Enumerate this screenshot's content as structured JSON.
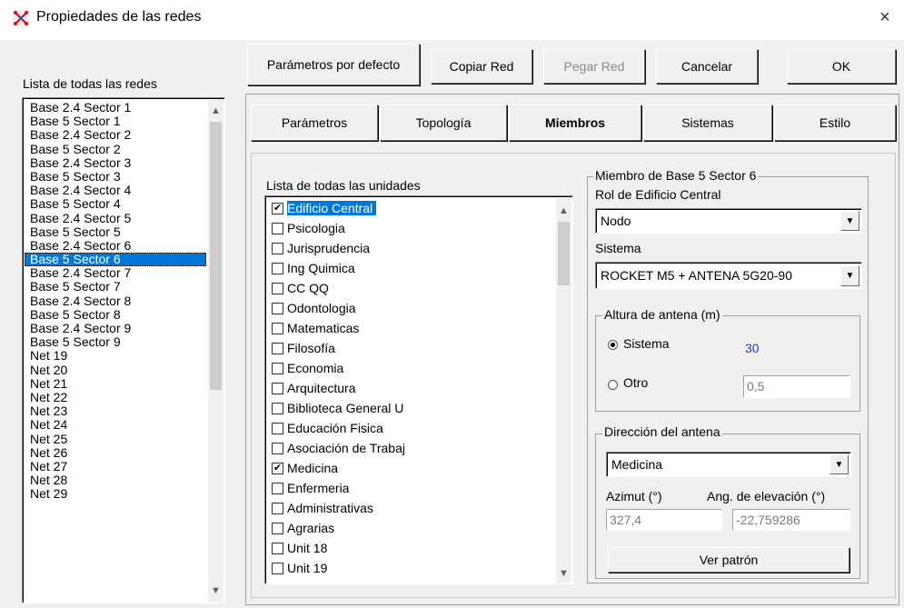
{
  "window": {
    "title": "Propiedades de las redes",
    "close_glyph": "×"
  },
  "left": {
    "label": "Lista de todas las redes",
    "nets": [
      "Base 2.4 Sector 1",
      "Base 5 Sector 1",
      "Base 2.4 Sector 2",
      "Base 5 Sector 2",
      "Base 2.4 Sector 3",
      "Base 5 Sector 3",
      "Base 2.4 Sector 4",
      "Base 5 Sector 4",
      "Base 2.4 Sector 5",
      "Base 5 Sector 5",
      "Base 2.4 Sector 6",
      "Base 5 Sector 6",
      "Base 2.4 Sector 7",
      "Base 5 Sector 7",
      "Base 2.4 Sector 8",
      "Base 5 Sector 8",
      "Base 2.4 Sector 9",
      "Base 5 Sector 9",
      "Net 19",
      "Net 20",
      "Net 21",
      "Net 22",
      "Net 23",
      "Net 24",
      "Net 25",
      "Net 26",
      "Net 27",
      "Net 28",
      "Net 29"
    ],
    "selected_index": 11
  },
  "toolbar": {
    "defaults": "Parámetros por defecto",
    "copy": "Copiar Red",
    "paste": "Pegar Red",
    "cancel": "Cancelar",
    "ok": "OK"
  },
  "tabs": [
    {
      "label": "Parámetros",
      "active": false
    },
    {
      "label": "Topología",
      "active": false
    },
    {
      "label": "Miembros",
      "active": true
    },
    {
      "label": "Sistemas",
      "active": false
    },
    {
      "label": "Estilo",
      "active": false
    }
  ],
  "units": {
    "label": "Lista de todas las unidades",
    "items": [
      {
        "name": "Edificio Central",
        "checked": true,
        "selected": true
      },
      {
        "name": "Psicologia",
        "checked": false
      },
      {
        "name": "Jurisprudencia",
        "checked": false
      },
      {
        "name": "Ing Quimica",
        "checked": false
      },
      {
        "name": "CC QQ",
        "checked": false
      },
      {
        "name": "Odontologia",
        "checked": false
      },
      {
        "name": "Matematicas",
        "checked": false
      },
      {
        "name": "Filosofía",
        "checked": false
      },
      {
        "name": "Economia",
        "checked": false
      },
      {
        "name": "Arquitectura",
        "checked": false
      },
      {
        "name": "Biblioteca General U",
        "checked": false
      },
      {
        "name": "Educación Fisica",
        "checked": false
      },
      {
        "name": "Asociación de Trabaj",
        "checked": false
      },
      {
        "name": "Medicina",
        "checked": true
      },
      {
        "name": "Enfermeria",
        "checked": false
      },
      {
        "name": "Administrativas",
        "checked": false
      },
      {
        "name": "Agrarias",
        "checked": false
      },
      {
        "name": "Unit  18",
        "checked": false
      },
      {
        "name": "Unit  19",
        "checked": false
      }
    ]
  },
  "member": {
    "group_title": "Miembro de Base 5 Sector 6",
    "role_label": "Rol de Edificio Central",
    "role_value": "Nodo",
    "system_label": "Sistema",
    "system_value": "ROCKET M5 + ANTENA 5G20-90",
    "height_group": "Altura de antena (m)",
    "radio_system": "Sistema",
    "system_height": "30",
    "radio_other": "Otro",
    "other_value": "0,5",
    "direction_group": "Dirección del antena",
    "direction_value": "Medicina",
    "azimuth_label": "Azimut (°)",
    "elevation_label": "Ang. de elevación (°)",
    "azimuth_value": "327,4",
    "elevation_value": "-22,759286",
    "pattern_button": "Ver patrón"
  },
  "colors": {
    "selection": "#0078d7",
    "value_blue": "#1a3fd8"
  }
}
